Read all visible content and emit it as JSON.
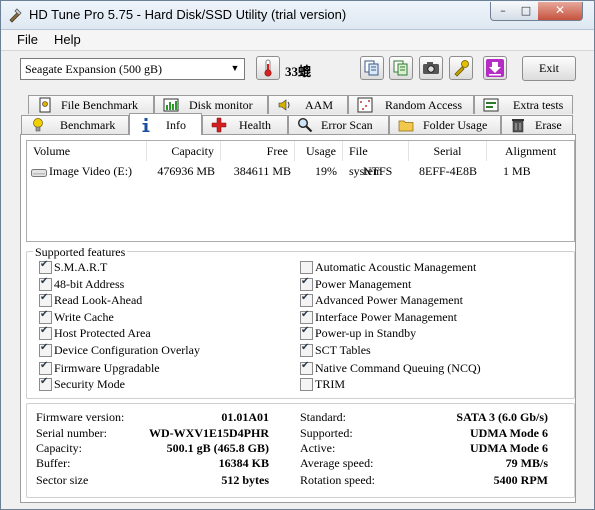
{
  "window": {
    "title": "HD Tune Pro 5.75 - Hard Disk/SSD Utility (trial version)"
  },
  "menu": {
    "file": "File",
    "help": "Help"
  },
  "toolbar": {
    "drive": "Seagate Expansion (500 gB)",
    "temperature": "33螕",
    "exit_label": "Exit"
  },
  "tabs_top": [
    "File Benchmark",
    "Disk monitor",
    "AAM",
    "Random Access",
    "Extra tests"
  ],
  "tabs_bottom": [
    "Benchmark",
    "Info",
    "Health",
    "Error Scan",
    "Folder Usage",
    "Erase"
  ],
  "volumes": {
    "headers": [
      "Volume",
      "Capacity",
      "Free",
      "Usage",
      "File system",
      "Serial",
      "Alignment"
    ],
    "rows": [
      [
        "Image Video (E:)",
        "476936 MB",
        "384611 MB",
        "19%",
        "NTFS",
        "8EFF-4E8B",
        "1 MB"
      ]
    ]
  },
  "features": {
    "title": "Supported features",
    "left": [
      {
        "label": "S.M.A.R.T",
        "checked": true
      },
      {
        "label": "48-bit Address",
        "checked": true
      },
      {
        "label": "Read Look-Ahead",
        "checked": true
      },
      {
        "label": "Write Cache",
        "checked": true
      },
      {
        "label": "Host Protected Area",
        "checked": true
      },
      {
        "label": "Device Configuration Overlay",
        "checked": true
      },
      {
        "label": "Firmware Upgradable",
        "checked": true
      },
      {
        "label": "Security Mode",
        "checked": true
      }
    ],
    "right": [
      {
        "label": "Automatic Acoustic Management",
        "checked": false
      },
      {
        "label": "Power Management",
        "checked": true
      },
      {
        "label": "Advanced Power Management",
        "checked": true
      },
      {
        "label": "Interface Power Management",
        "checked": true
      },
      {
        "label": "Power-up in Standby",
        "checked": true
      },
      {
        "label": "SCT Tables",
        "checked": true
      },
      {
        "label": "Native Command Queuing (NCQ)",
        "checked": true
      },
      {
        "label": "TRIM",
        "checked": false
      }
    ]
  },
  "info": {
    "left": [
      {
        "label": "Firmware version:",
        "value": "01.01A01"
      },
      {
        "label": "Serial number:",
        "value": "WD-WXV1E15D4PHR"
      },
      {
        "label": "Capacity:",
        "value": "500.1 gB (465.8 GB)"
      },
      {
        "label": "Buffer:",
        "value": "16384 KB"
      },
      {
        "label": "Sector size",
        "value": "512 bytes"
      }
    ],
    "right": [
      {
        "label": "Standard:",
        "value": "SATA 3 (6.0 Gb/s)"
      },
      {
        "label": "Supported:",
        "value": "UDMA Mode 6"
      },
      {
        "label": "Active:",
        "value": "UDMA Mode 6"
      },
      {
        "label": "Average speed:",
        "value": "79 MB/s"
      },
      {
        "label": "Rotation speed:",
        "value": "5400 RPM"
      }
    ]
  }
}
